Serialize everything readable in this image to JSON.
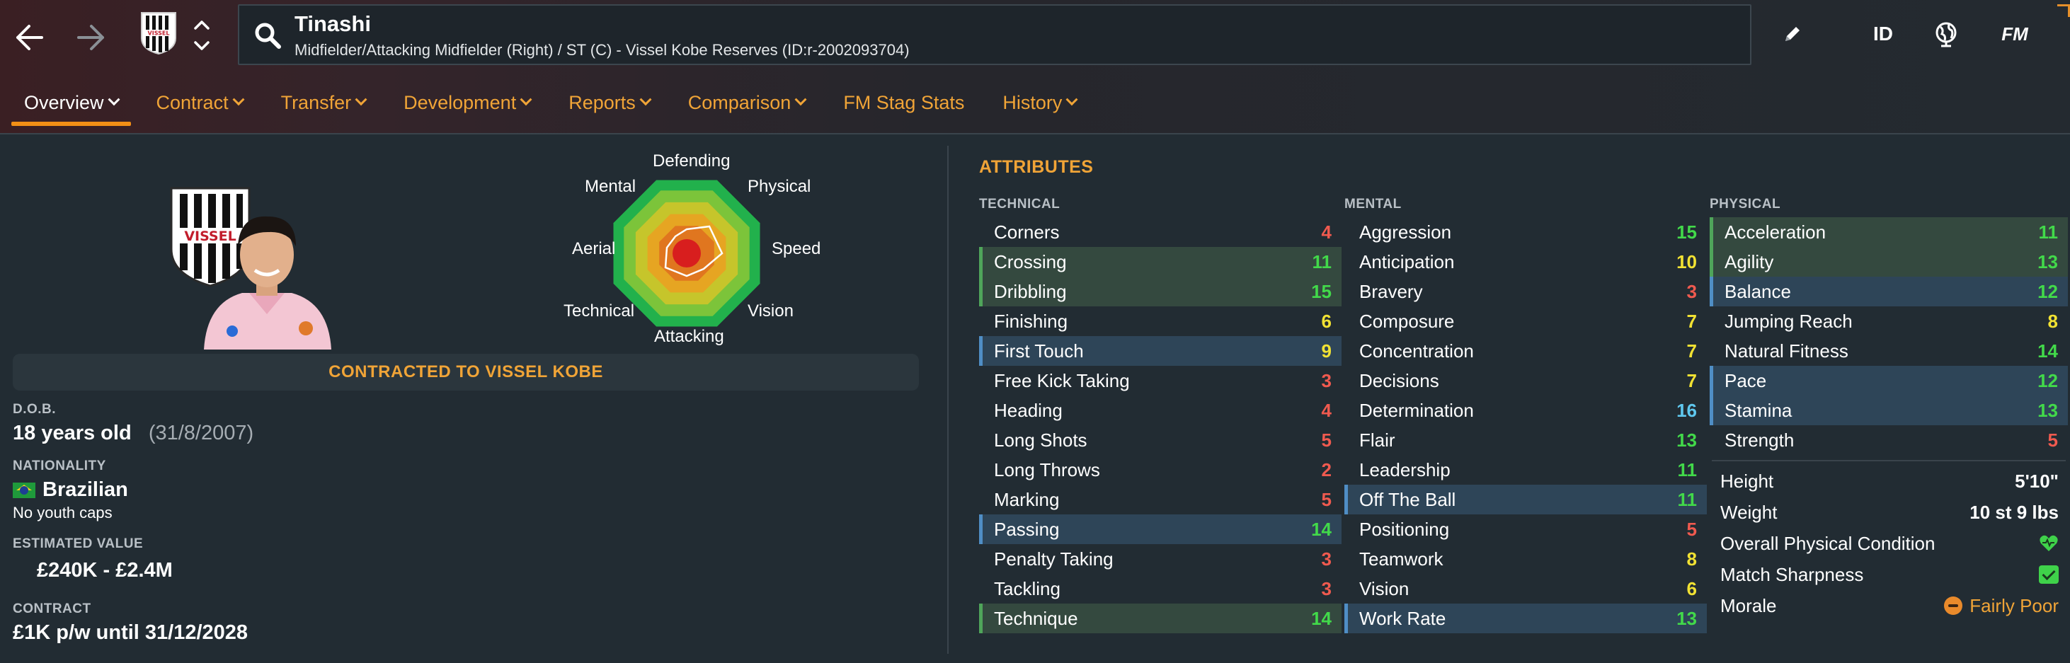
{
  "header": {
    "player_name": "Tinashi",
    "player_subtitle": "Midfielder/Attacking Midfielder (Right) / ST (C) - Vissel Kobe Reserves (ID:r-2002093704)",
    "id_label": "ID",
    "fm_label": "FM",
    "crest_text": "VISSEL"
  },
  "tabs": [
    {
      "label": "Overview"
    },
    {
      "label": "Contract"
    },
    {
      "label": "Transfer"
    },
    {
      "label": "Development"
    },
    {
      "label": "Reports"
    },
    {
      "label": "Comparison"
    },
    {
      "label": "FM Stag Stats"
    },
    {
      "label": "History"
    }
  ],
  "radar": {
    "labels": [
      "Defending",
      "Physical",
      "Speed",
      "Vision",
      "Attacking",
      "Technical",
      "Aerial",
      "Mental"
    ]
  },
  "profile": {
    "contract_banner": "CONTRACTED TO VISSEL KOBE",
    "dob_label": "D.O.B.",
    "age": "18 years old",
    "dob": "(31/8/2007)",
    "nationality_label": "NATIONALITY",
    "nationality": "Brazilian",
    "youth_caps": "No youth caps",
    "value_label": "ESTIMATED VALUE",
    "value": "£240K - £2.4M",
    "contract_label": "CONTRACT",
    "contract": "£1K p/w until 31/12/2028"
  },
  "attributes": {
    "title": "ATTRIBUTES",
    "technical_title": "TECHNICAL",
    "mental_title": "MENTAL",
    "physical_title": "PHYSICAL",
    "technical": [
      {
        "name": "Corners",
        "value": "4"
      },
      {
        "name": "Crossing",
        "value": "11"
      },
      {
        "name": "Dribbling",
        "value": "15"
      },
      {
        "name": "Finishing",
        "value": "6"
      },
      {
        "name": "First Touch",
        "value": "9"
      },
      {
        "name": "Free Kick Taking",
        "value": "3"
      },
      {
        "name": "Heading",
        "value": "4"
      },
      {
        "name": "Long Shots",
        "value": "5"
      },
      {
        "name": "Long Throws",
        "value": "2"
      },
      {
        "name": "Marking",
        "value": "5"
      },
      {
        "name": "Passing",
        "value": "14"
      },
      {
        "name": "Penalty Taking",
        "value": "3"
      },
      {
        "name": "Tackling",
        "value": "3"
      },
      {
        "name": "Technique",
        "value": "14"
      }
    ],
    "mental": [
      {
        "name": "Aggression",
        "value": "15"
      },
      {
        "name": "Anticipation",
        "value": "10"
      },
      {
        "name": "Bravery",
        "value": "3"
      },
      {
        "name": "Composure",
        "value": "7"
      },
      {
        "name": "Concentration",
        "value": "7"
      },
      {
        "name": "Decisions",
        "value": "7"
      },
      {
        "name": "Determination",
        "value": "16"
      },
      {
        "name": "Flair",
        "value": "13"
      },
      {
        "name": "Leadership",
        "value": "11"
      },
      {
        "name": "Off The Ball",
        "value": "11"
      },
      {
        "name": "Positioning",
        "value": "5"
      },
      {
        "name": "Teamwork",
        "value": "8"
      },
      {
        "name": "Vision",
        "value": "6"
      },
      {
        "name": "Work Rate",
        "value": "13"
      }
    ],
    "physical": [
      {
        "name": "Acceleration",
        "value": "11"
      },
      {
        "name": "Agility",
        "value": "13"
      },
      {
        "name": "Balance",
        "value": "12"
      },
      {
        "name": "Jumping Reach",
        "value": "8"
      },
      {
        "name": "Natural Fitness",
        "value": "14"
      },
      {
        "name": "Pace",
        "value": "12"
      },
      {
        "name": "Stamina",
        "value": "13"
      },
      {
        "name": "Strength",
        "value": "5"
      }
    ]
  },
  "physical_info": {
    "height_label": "Height",
    "height": "5'10\"",
    "weight_label": "Weight",
    "weight": "10 st 9 lbs",
    "condition_label": "Overall Physical Condition",
    "sharpness_label": "Match Sharpness",
    "morale_label": "Morale",
    "morale": "Fairly Poor"
  },
  "colors": {
    "accent": "#f0a437",
    "tab_underline": "#f28f16",
    "value_low": "#f05a4f",
    "value_mid": "#f2e233",
    "value_high": "#42d94a",
    "value_top": "#5fc8ef"
  }
}
